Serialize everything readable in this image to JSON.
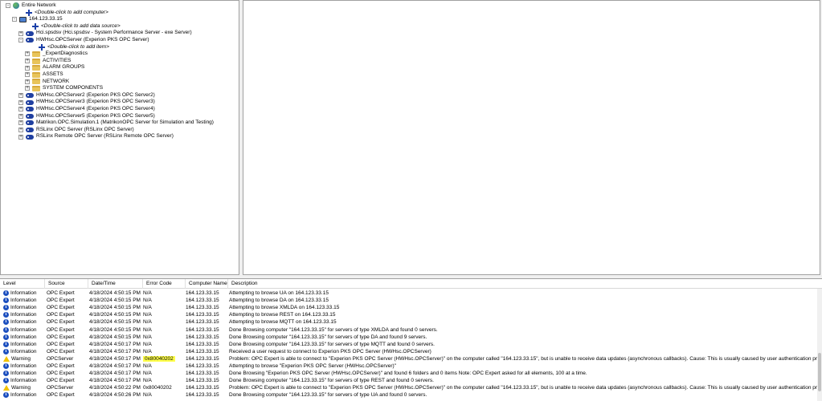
{
  "tree": [
    {
      "label": "Entire Network",
      "icon": "globe-icon",
      "exp": "-"
    },
    {
      "label": "<Double-click to add computer>",
      "icon": "add-icon",
      "italic": true
    },
    {
      "label": "164.123.33.15",
      "icon": "computer-icon",
      "exp": "-"
    },
    {
      "label": "<Double-click to add data source>",
      "icon": "add-icon",
      "italic": true
    },
    {
      "label": "Hci.spsdsv (Hci.spsdsv - System Performance Server - exe Server)",
      "icon": "server-icon",
      "exp": "+"
    },
    {
      "label": "HWHsc.OPCServer (Experion PKS OPC Server)",
      "icon": "server-icon",
      "exp": "-"
    },
    {
      "label": "<Double-click to add item>",
      "icon": "add-icon",
      "italic": true
    },
    {
      "label": "_ExpertDiagnostics",
      "icon": "folder-icon",
      "exp": "+"
    },
    {
      "label": "ACTIVITIES",
      "icon": "folder-icon",
      "exp": "+"
    },
    {
      "label": "ALARM GROUPS",
      "icon": "folder-icon",
      "exp": "+"
    },
    {
      "label": "ASSETS",
      "icon": "folder-icon",
      "exp": "+"
    },
    {
      "label": "NETWORK",
      "icon": "folder-icon",
      "exp": "+"
    },
    {
      "label": "SYSTEM COMPONENTS",
      "icon": "folder-icon",
      "exp": "+"
    },
    {
      "label": "HWHsc.OPCServer2 (Experion PKS OPC Server2)",
      "icon": "server-icon",
      "exp": "+"
    },
    {
      "label": "HWHsc.OPCServer3 (Experion PKS OPC Server3)",
      "icon": "server-icon",
      "exp": "+"
    },
    {
      "label": "HWHsc.OPCServer4 (Experion PKS OPC Server4)",
      "icon": "server-icon",
      "exp": "+"
    },
    {
      "label": "HWHsc.OPCServer5 (Experion PKS OPC Server5)",
      "icon": "server-icon",
      "exp": "+"
    },
    {
      "label": "Matrikon.OPC.Simulation.1 (MatrikonOPC Server for Simulation and Testing)",
      "icon": "server-icon",
      "exp": "+"
    },
    {
      "label": "RSLinx OPC Server (RSLinx OPC Server)",
      "icon": "server-icon",
      "exp": "+"
    },
    {
      "label": "RSLinx Remote OPC Server (RSLinx Remote OPC Server)",
      "icon": "server-icon",
      "exp": "+"
    }
  ],
  "log": {
    "columns": [
      "Level",
      "Source",
      "Date/Time",
      "Error Code",
      "Computer Name",
      "Description"
    ],
    "rows": [
      {
        "level": "Information",
        "source": "OPC Expert",
        "date": "4/18/2024 4:50:15 PM",
        "err": "N/A",
        "comp": "164.123.33.15",
        "desc": "Attempting to browse UA on 164.123.33.15"
      },
      {
        "level": "Information",
        "source": "OPC Expert",
        "date": "4/18/2024 4:50:15 PM",
        "err": "N/A",
        "comp": "164.123.33.15",
        "desc": "Attempting to browse DA on 164.123.33.15"
      },
      {
        "level": "Information",
        "source": "OPC Expert",
        "date": "4/18/2024 4:50:15 PM",
        "err": "N/A",
        "comp": "164.123.33.15",
        "desc": "Attempting to browse XMLDA on 164.123.33.15"
      },
      {
        "level": "Information",
        "source": "OPC Expert",
        "date": "4/18/2024 4:50:15 PM",
        "err": "N/A",
        "comp": "164.123.33.15",
        "desc": "Attempting to browse REST on 164.123.33.15"
      },
      {
        "level": "Information",
        "source": "OPC Expert",
        "date": "4/18/2024 4:50:15 PM",
        "err": "N/A",
        "comp": "164.123.33.15",
        "desc": "Attempting to browse MQTT on 164.123.33.15"
      },
      {
        "level": "Information",
        "source": "OPC Expert",
        "date": "4/18/2024 4:50:15 PM",
        "err": "N/A",
        "comp": "164.123.33.15",
        "desc": "Done Browsing computer \"164.123.33.15\" for servers of type XMLDA and found 0 servers."
      },
      {
        "level": "Information",
        "source": "OPC Expert",
        "date": "4/18/2024 4:50:15 PM",
        "err": "N/A",
        "comp": "164.123.33.15",
        "desc": "Done Browsing computer \"164.123.33.15\" for servers of type DA and found 9 servers."
      },
      {
        "level": "Information",
        "source": "OPC Expert",
        "date": "4/18/2024 4:50:17 PM",
        "err": "N/A",
        "comp": "164.123.33.15",
        "desc": "Done Browsing computer \"164.123.33.15\" for servers of type MQTT and found 0 servers."
      },
      {
        "level": "Information",
        "source": "OPC Expert",
        "date": "4/18/2024 4:50:17 PM",
        "err": "N/A",
        "comp": "164.123.33.15",
        "desc": "Received a user request to connect to Experion PKS OPC Server (HWHsc.OPCServer)"
      },
      {
        "level": "Warning",
        "source": "OPCServer",
        "date": "4/18/2024 4:50:17 PM",
        "err": "0x80040202",
        "highlight": true,
        "comp": "164.123.33.15",
        "desc": "Problem: OPC Expert is able to connect to \"Experion PKS OPC Server (HWHsc.OPCServer)\" on the computer called \"164.123.33.15\", but is unable to receive data updates (asynchronous callbacks).      Cause: This is usually caused by user authentication problem"
      },
      {
        "level": "Information",
        "source": "OPC Expert",
        "date": "4/18/2024 4:50:17 PM",
        "err": "N/A",
        "comp": "164.123.33.15",
        "desc": "Attempting to browse \"Experion PKS OPC Server (HWHsc.OPCServer)\""
      },
      {
        "level": "Information",
        "source": "OPC Expert",
        "date": "4/18/2024 4:50:17 PM",
        "err": "N/A",
        "comp": "164.123.33.15",
        "desc": "Done Browsing \"Experion PKS OPC Server (HWHsc.OPCServer)\" and found 6 folders and 0 items Note: OPC Expert asked for all elements, 100 at a time."
      },
      {
        "level": "Information",
        "source": "OPC Expert",
        "date": "4/18/2024 4:50:17 PM",
        "err": "N/A",
        "comp": "164.123.33.15",
        "desc": "Done Browsing computer \"164.123.33.15\" for servers of type REST and found 0 servers."
      },
      {
        "level": "Warning",
        "source": "OPCServer",
        "date": "4/18/2024 4:50:22 PM",
        "err": "0x80040202",
        "comp": "164.123.33.15",
        "desc": "Problem: OPC Expert is able to connect to \"Experion PKS OPC Server (HWHsc.OPCServer)\" on the computer called \"164.123.33.15\", but is unable to receive data updates (asynchronous callbacks).      Cause: This is usually caused by user authentication problem"
      },
      {
        "level": "Information",
        "source": "OPC Expert",
        "date": "4/18/2024 4:50:26 PM",
        "err": "N/A",
        "comp": "164.123.33.15",
        "desc": "Done Browsing computer \"164.123.33.15\" for servers of type UA and found 0 servers."
      }
    ]
  },
  "colors": {
    "highlight": "#ffff4a",
    "info": "#1c4fbf",
    "warning": "#f2c200"
  }
}
